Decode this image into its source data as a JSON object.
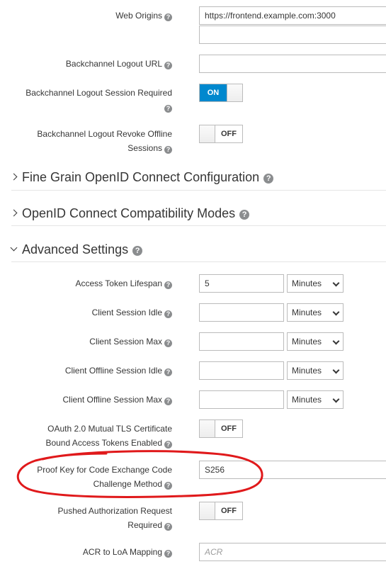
{
  "web_origins": {
    "label": "Web Origins",
    "value": "https://frontend.example.com:3000",
    "value2": ""
  },
  "backchannel_logout_url": {
    "label": "Backchannel Logout URL",
    "value": ""
  },
  "backchannel_logout_session_required": {
    "label_line1": "Backchannel Logout Session Required",
    "state": "ON"
  },
  "backchannel_logout_revoke_offline": {
    "label_line1": "Backchannel Logout Revoke Offline",
    "label_line2": "Sessions",
    "state": "OFF"
  },
  "sections": {
    "fine_grain": "Fine Grain OpenID Connect Configuration",
    "compat": "OpenID Connect Compatibility Modes",
    "advanced": "Advanced Settings"
  },
  "access_token_lifespan": {
    "label": "Access Token Lifespan",
    "value": "5",
    "unit": "Minutes"
  },
  "client_session_idle": {
    "label": "Client Session Idle",
    "value": "",
    "unit": "Minutes"
  },
  "client_session_max": {
    "label": "Client Session Max",
    "value": "",
    "unit": "Minutes"
  },
  "client_offline_session_idle": {
    "label": "Client Offline Session Idle",
    "value": "",
    "unit": "Minutes"
  },
  "client_offline_session_max": {
    "label": "Client Offline Session Max",
    "value": "",
    "unit": "Minutes"
  },
  "oauth_mtls": {
    "label_line1": "OAuth 2.0 Mutual TLS Certificate",
    "label_line2": "Bound Access Tokens Enabled",
    "state": "OFF"
  },
  "pkce": {
    "label_line1": "Proof Key for Code Exchange Code",
    "label_line2": "Challenge Method",
    "value": "S256"
  },
  "par": {
    "label_line1": "Pushed Authorization Request",
    "label_line2": "Required",
    "state": "OFF"
  },
  "acr": {
    "label": "ACR to LoA Mapping",
    "placeholder": "ACR"
  },
  "colors": {
    "accent": "#0088ce",
    "annotation": "#e0191b"
  }
}
